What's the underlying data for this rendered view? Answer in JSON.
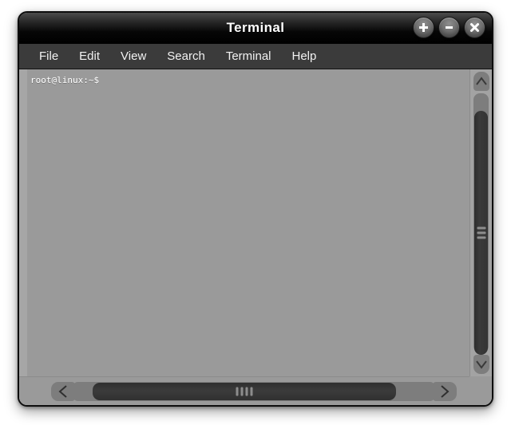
{
  "window": {
    "title": "Terminal",
    "controls": [
      {
        "name": "maximize-button",
        "icon": "plus-icon",
        "label": "+"
      },
      {
        "name": "minimize-button",
        "icon": "minus-icon",
        "label": "−"
      },
      {
        "name": "close-button",
        "icon": "close-icon",
        "label": "×"
      }
    ]
  },
  "menubar": {
    "items": [
      {
        "label": "File"
      },
      {
        "label": "Edit"
      },
      {
        "label": "View"
      },
      {
        "label": "Search"
      },
      {
        "label": "Terminal"
      },
      {
        "label": "Help"
      }
    ]
  },
  "terminal": {
    "prompt": "root@linux:~$",
    "content": "root@linux:~$",
    "background_color": "#9a9a9a",
    "text_color": "#ffffff"
  },
  "scrollbars": {
    "vertical": {
      "up_arrow_icon": "chevron-up-icon",
      "down_arrow_icon": "chevron-down-icon",
      "up_glyph": "∧",
      "down_glyph": "∨"
    },
    "horizontal": {
      "left_arrow_icon": "chevron-left-icon",
      "right_arrow_icon": "chevron-right-icon",
      "left_glyph": "<",
      "right_glyph": ">"
    }
  },
  "colors": {
    "titlebar": "#000000",
    "menubar": "#3b3b3b",
    "window_chrome": "#9a9a9a",
    "scroll_thumb": "#333333",
    "page_background": "#ffffff"
  }
}
